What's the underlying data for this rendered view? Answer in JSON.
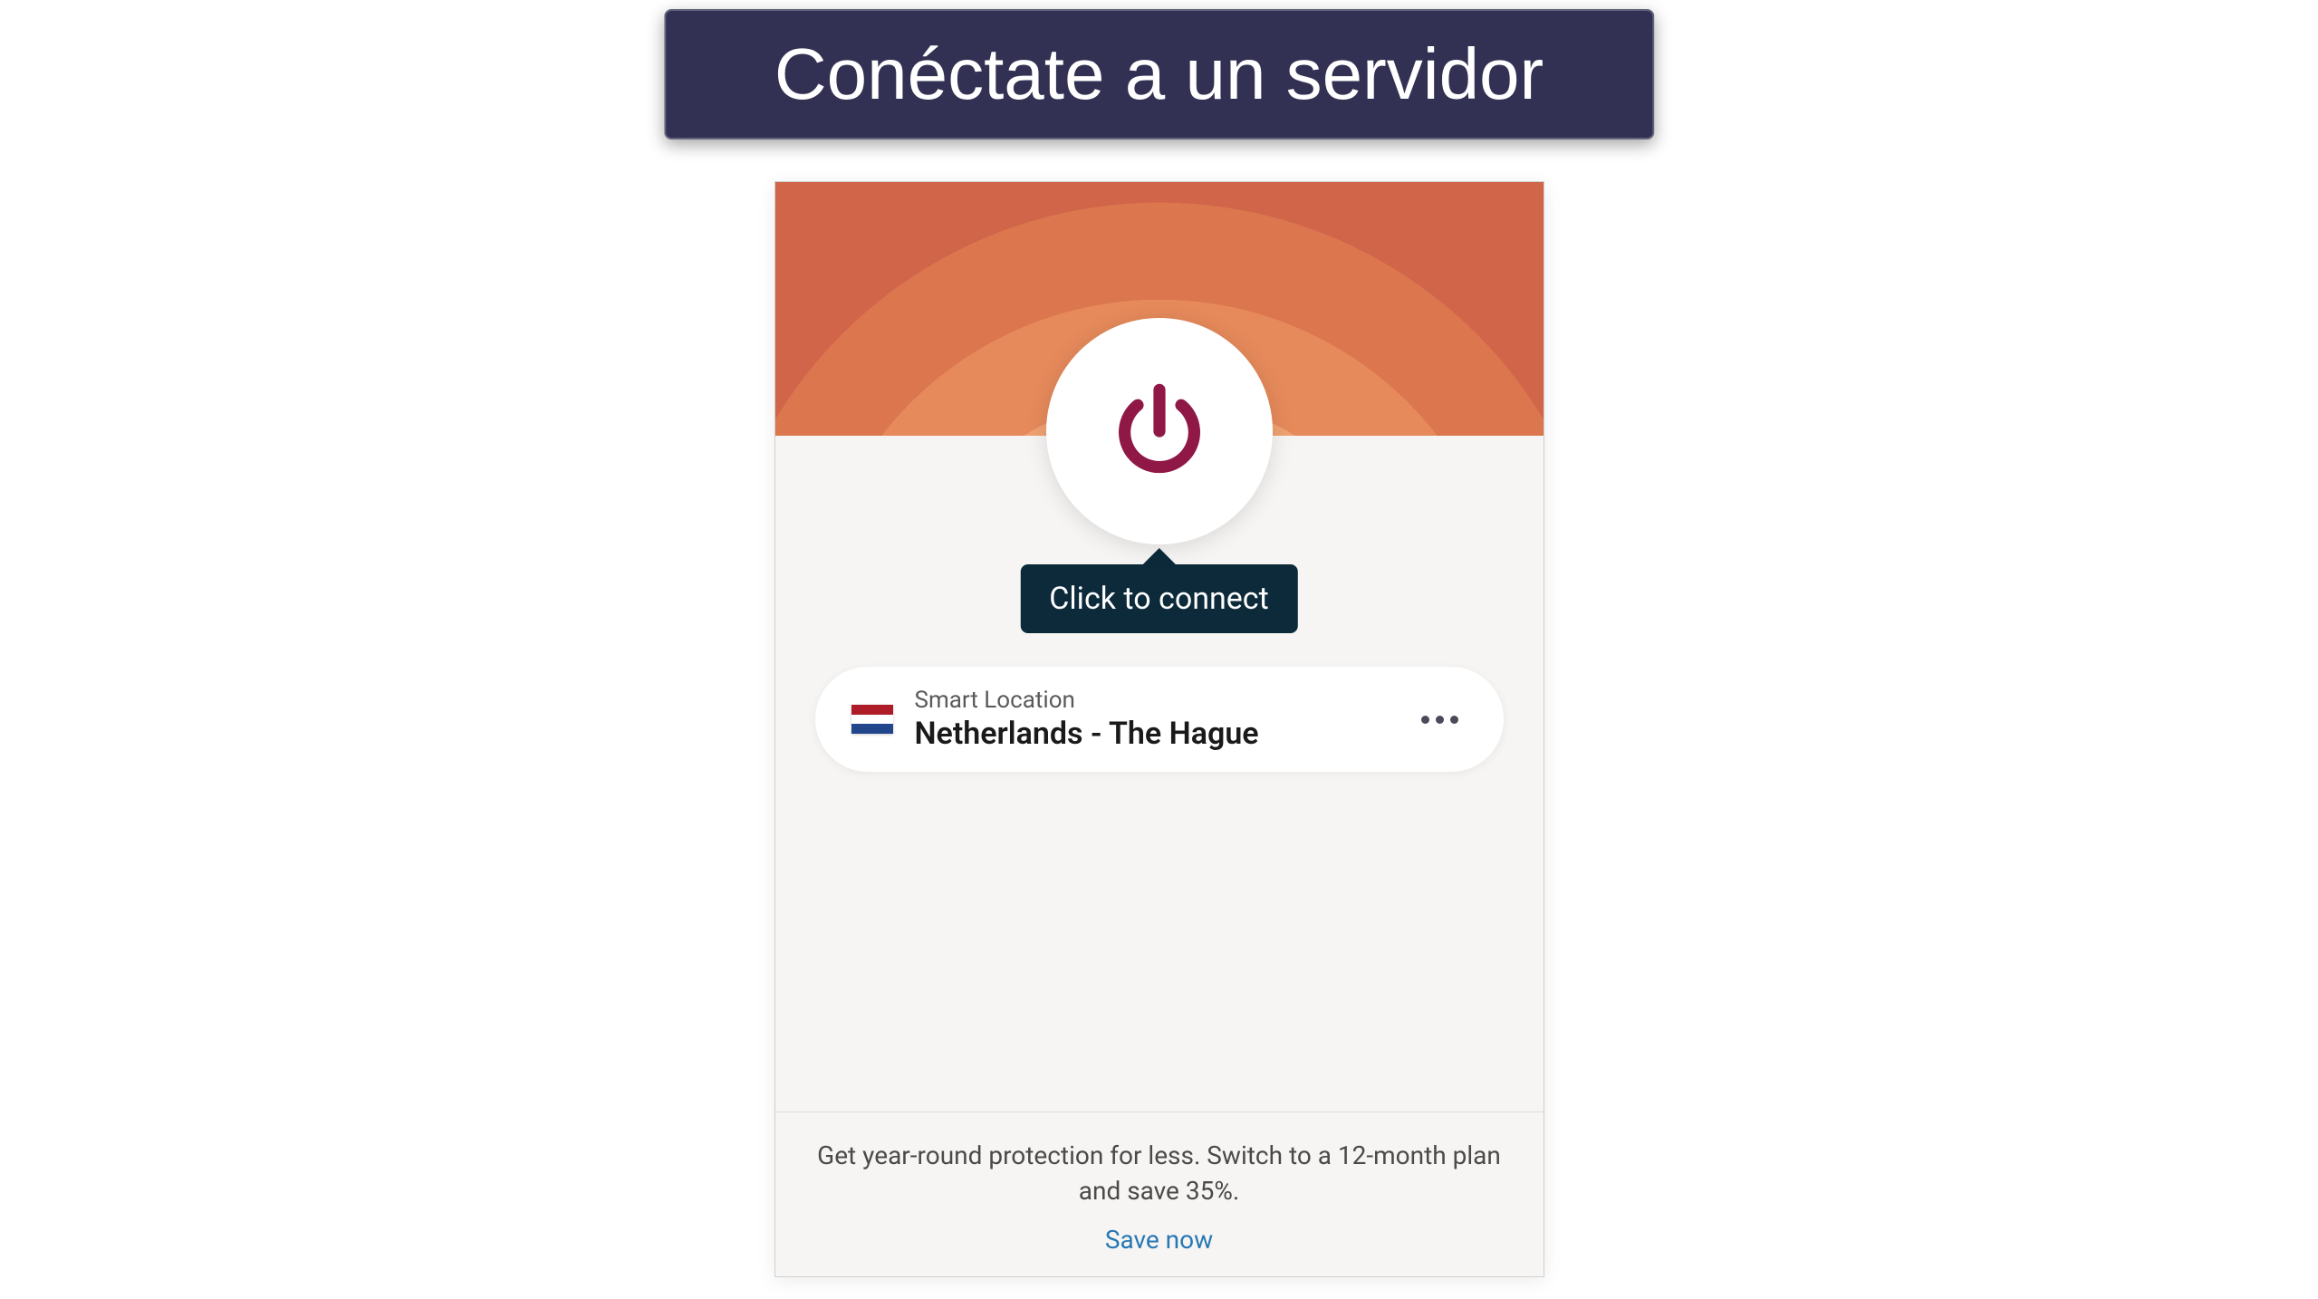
{
  "banner": {
    "title": "Conéctate a un servidor"
  },
  "app": {
    "tooltip": "Click to connect",
    "location": {
      "label": "Smart Location",
      "name": "Netherlands - The Hague",
      "flag_country": "Netherlands"
    },
    "promo": {
      "text": "Get year-round protection for less. Switch to a 12-month plan and save 35%.",
      "link": "Save now"
    }
  },
  "colors": {
    "banner_bg": "#323153",
    "tooltip_bg": "#0c2a3a",
    "power_icon": "#8f1846",
    "link": "#2878b4"
  }
}
